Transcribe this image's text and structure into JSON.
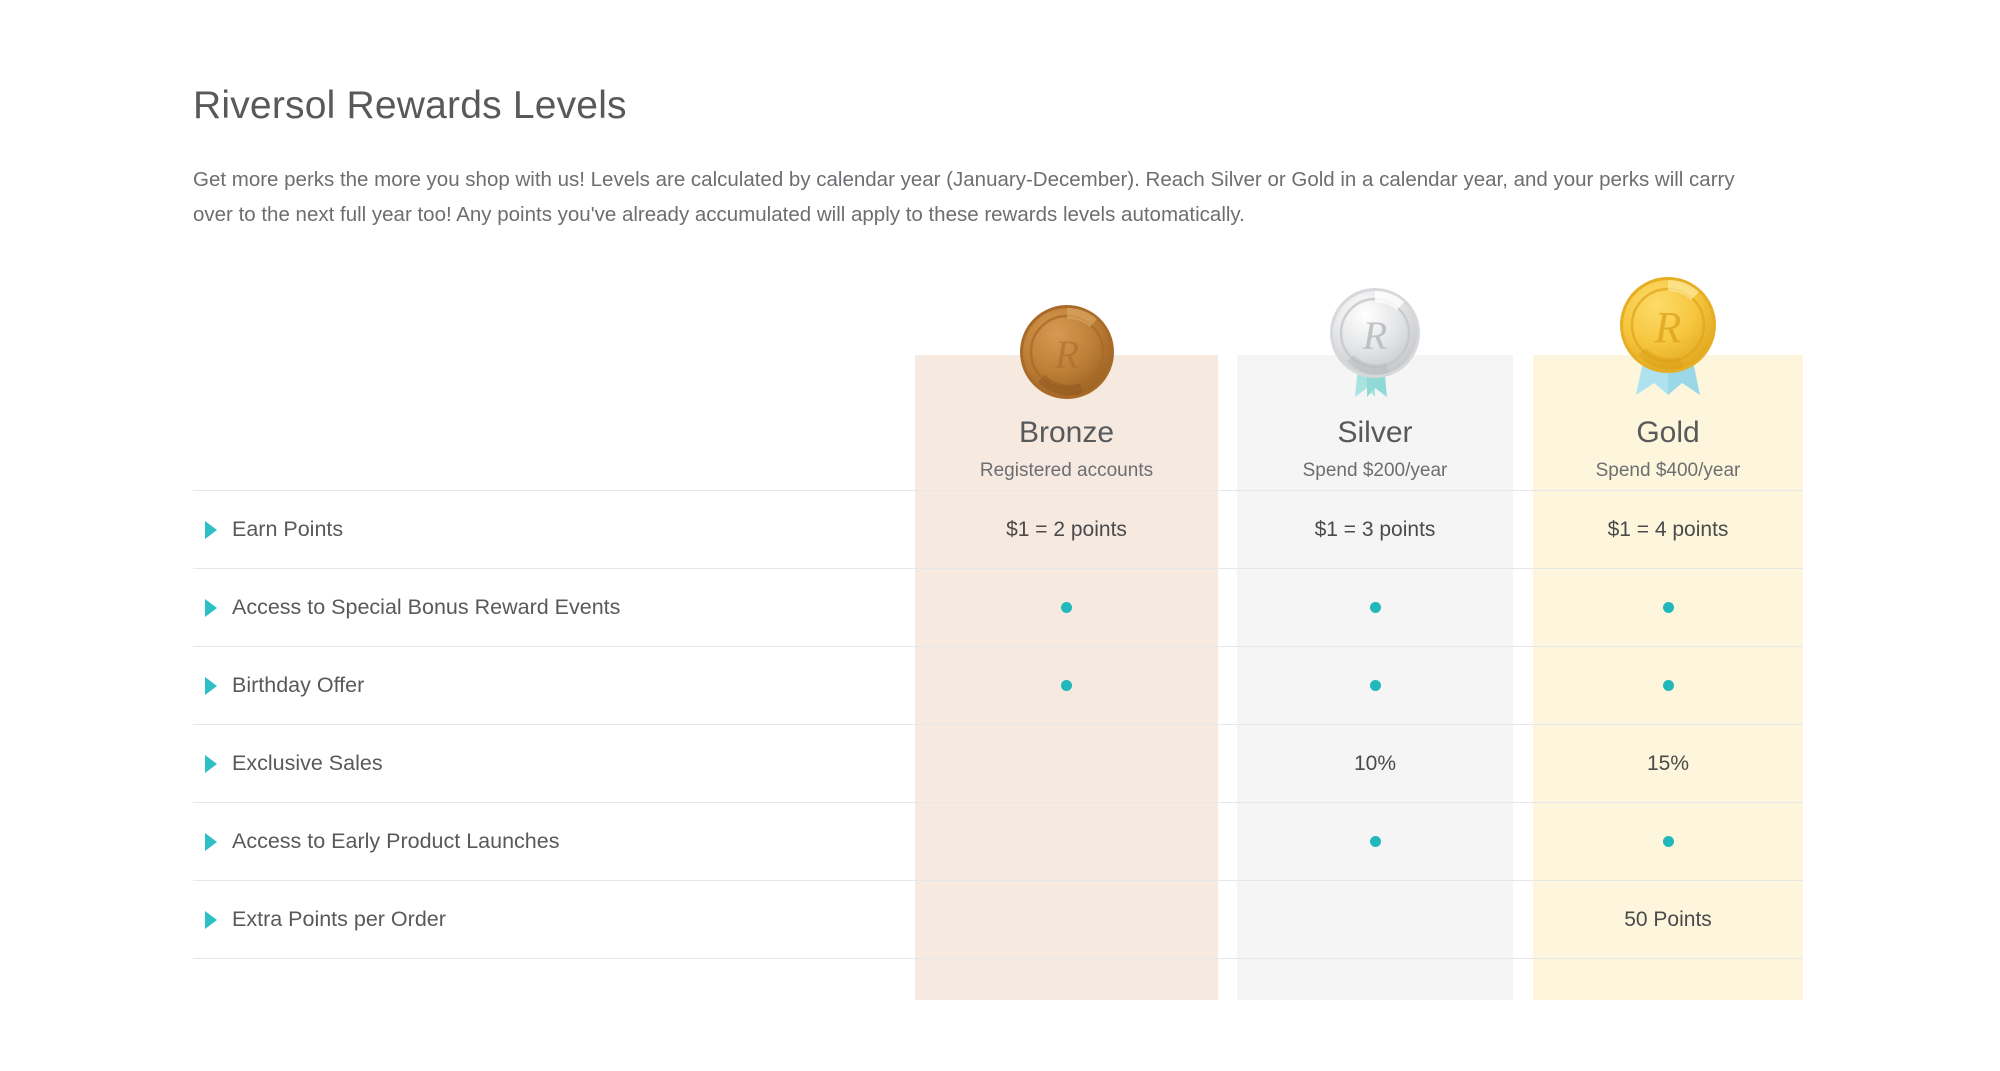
{
  "header": {
    "title": "Riversol Rewards Levels",
    "intro": "Get more perks the more you shop with us! Levels are calculated by calendar year (January-December). Reach Silver or Gold in a calendar year, and your perks will carry over to the next full year too! Any points you've already accumulated will apply to these rewards levels automatically."
  },
  "colors": {
    "accent_teal": "#2cc0c4",
    "dot_teal": "#22b8bb",
    "bronze_band": "#f5e9e0",
    "silver_band": "#f5f5f5",
    "gold_band": "#fdf6dc",
    "title_gray": "#58595b",
    "body_gray": "#6d6e71",
    "rule_gray": "#e6e7e8"
  },
  "tiers": [
    {
      "key": "bronze",
      "name": "Bronze",
      "requirement": "Registered accounts",
      "medal_icon": "bronze-medal-icon"
    },
    {
      "key": "silver",
      "name": "Silver",
      "requirement": "Spend $200/year",
      "medal_icon": "silver-medal-icon"
    },
    {
      "key": "gold",
      "name": "Gold",
      "requirement": "Spend $400/year",
      "medal_icon": "gold-medal-icon"
    }
  ],
  "bullet_icon": "triangle-right-icon",
  "rows": [
    {
      "label": "Earn Points",
      "bronze": "$1 = 2 points",
      "silver": "$1 = 3 points",
      "gold": "$1 = 4 points"
    },
    {
      "label": "Access to Special Bonus Reward Events",
      "bronze": "•",
      "silver": "•",
      "gold": "•"
    },
    {
      "label": "Birthday Offer",
      "bronze": "•",
      "silver": "•",
      "gold": "•"
    },
    {
      "label": "Exclusive Sales",
      "bronze": "",
      "silver": "10%",
      "gold": "15%"
    },
    {
      "label": "Access to Early Product Launches",
      "bronze": "",
      "silver": "•",
      "gold": "•"
    },
    {
      "label": "Extra Points per Order",
      "bronze": "",
      "silver": "",
      "gold": "50 Points"
    }
  ]
}
